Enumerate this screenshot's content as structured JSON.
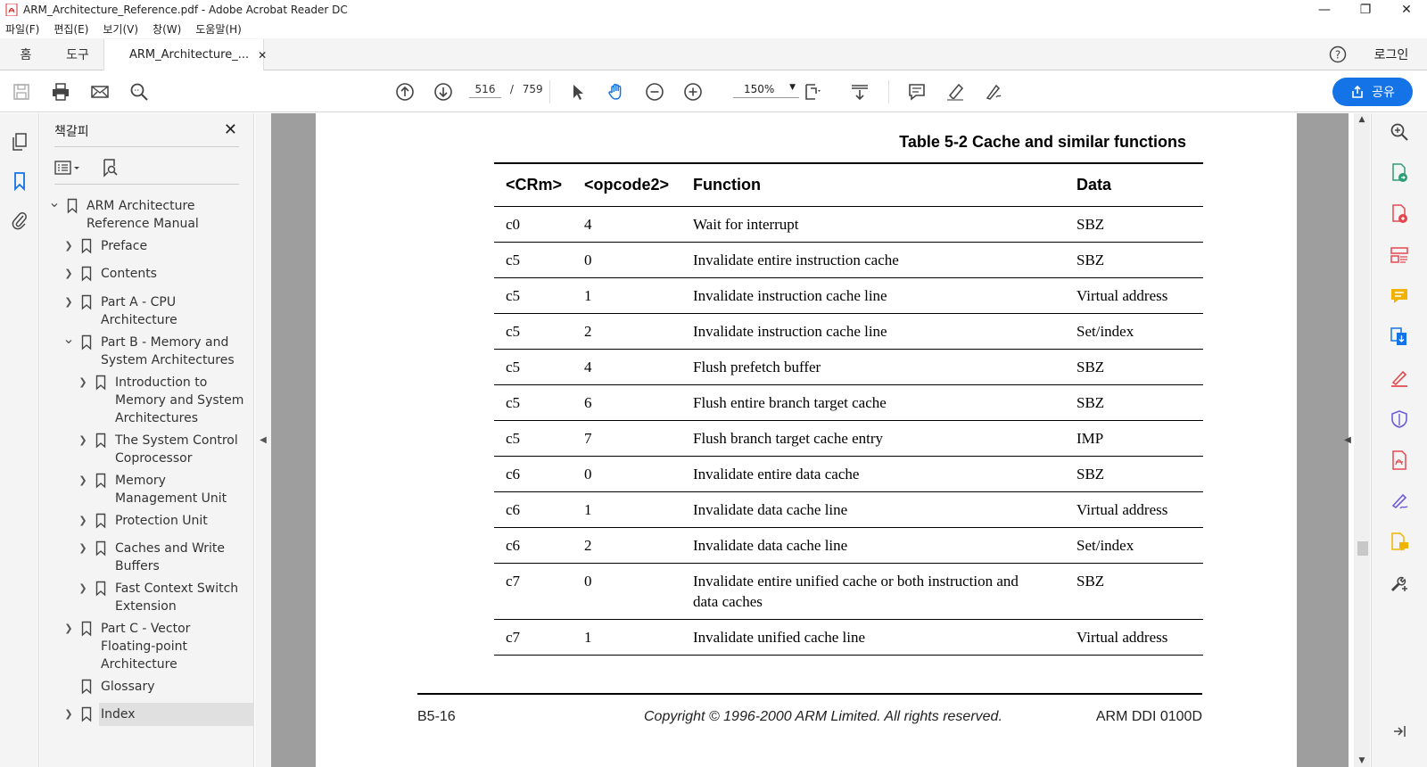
{
  "window": {
    "title": "ARM_Architecture_Reference.pdf - Adobe Acrobat Reader DC"
  },
  "menu": [
    "파일(F)",
    "편집(E)",
    "보기(V)",
    "창(W)",
    "도움말(H)"
  ],
  "tabs": {
    "home": "홈",
    "tools": "도구",
    "doc": "ARM_Architecture_...",
    "login": "로그인"
  },
  "toolbar": {
    "page_current": "516",
    "page_sep": "/",
    "page_total": "759",
    "zoom": "150%",
    "share": "공유"
  },
  "bookmarks": {
    "title": "책갈피",
    "items": [
      {
        "line1": "ARM Architecture",
        "line2": "Reference Manual"
      },
      {
        "line1": "Preface"
      },
      {
        "line1": "Contents"
      },
      {
        "line1": "Part A - CPU",
        "line2": "Architecture"
      },
      {
        "line1": "Part B - Memory and",
        "line2": "System Architectures"
      },
      {
        "line1": "Introduction to",
        "line2": "Memory and System",
        "line3": "Architectures"
      },
      {
        "line1": "The System Control",
        "line2": "Coprocessor"
      },
      {
        "line1": "Memory",
        "line2": "Management Unit"
      },
      {
        "line1": "Protection Unit"
      },
      {
        "line1": "Caches and Write",
        "line2": "Buffers"
      },
      {
        "line1": "Fast Context Switch",
        "line2": "Extension"
      },
      {
        "line1": "Part C -  Vector",
        "line2": "Floating-point",
        "line3": "Architecture"
      },
      {
        "line1": "Glossary"
      },
      {
        "line1": "Index"
      }
    ]
  },
  "document": {
    "caption": "Table 5-2 Cache and similar functions",
    "headers": [
      "<CRm>",
      "<opcode2>",
      "Function",
      "Data"
    ],
    "rows": [
      [
        "c0",
        "4",
        "Wait for interrupt",
        "SBZ"
      ],
      [
        "c5",
        "0",
        "Invalidate entire instruction cache",
        "SBZ"
      ],
      [
        "c5",
        "1",
        "Invalidate instruction cache line",
        "Virtual address"
      ],
      [
        "c5",
        "2",
        "Invalidate instruction cache line",
        "Set/index"
      ],
      [
        "c5",
        "4",
        "Flush prefetch buffer",
        "SBZ"
      ],
      [
        "c5",
        "6",
        "Flush entire branch target cache",
        "SBZ"
      ],
      [
        "c5",
        "7",
        "Flush branch target cache entry",
        "IMP"
      ],
      [
        "c6",
        "0",
        "Invalidate entire data cache",
        "SBZ"
      ],
      [
        "c6",
        "1",
        "Invalidate data cache line",
        "Virtual address"
      ],
      [
        "c6",
        "2",
        "Invalidate data cache line",
        "Set/index"
      ],
      [
        "c7",
        "0",
        "Invalidate entire unified cache or both instruction and data caches",
        "SBZ"
      ],
      [
        "c7",
        "1",
        "Invalidate unified cache line",
        "Virtual address"
      ]
    ],
    "footer": {
      "left": "B5-16",
      "middle": "Copyright © 1996-2000 ARM Limited. All rights reserved.",
      "right": "ARM DDI 0100D"
    }
  },
  "colors": {
    "accent": "#1473e6",
    "doc_bg": "#9e9e9e"
  }
}
